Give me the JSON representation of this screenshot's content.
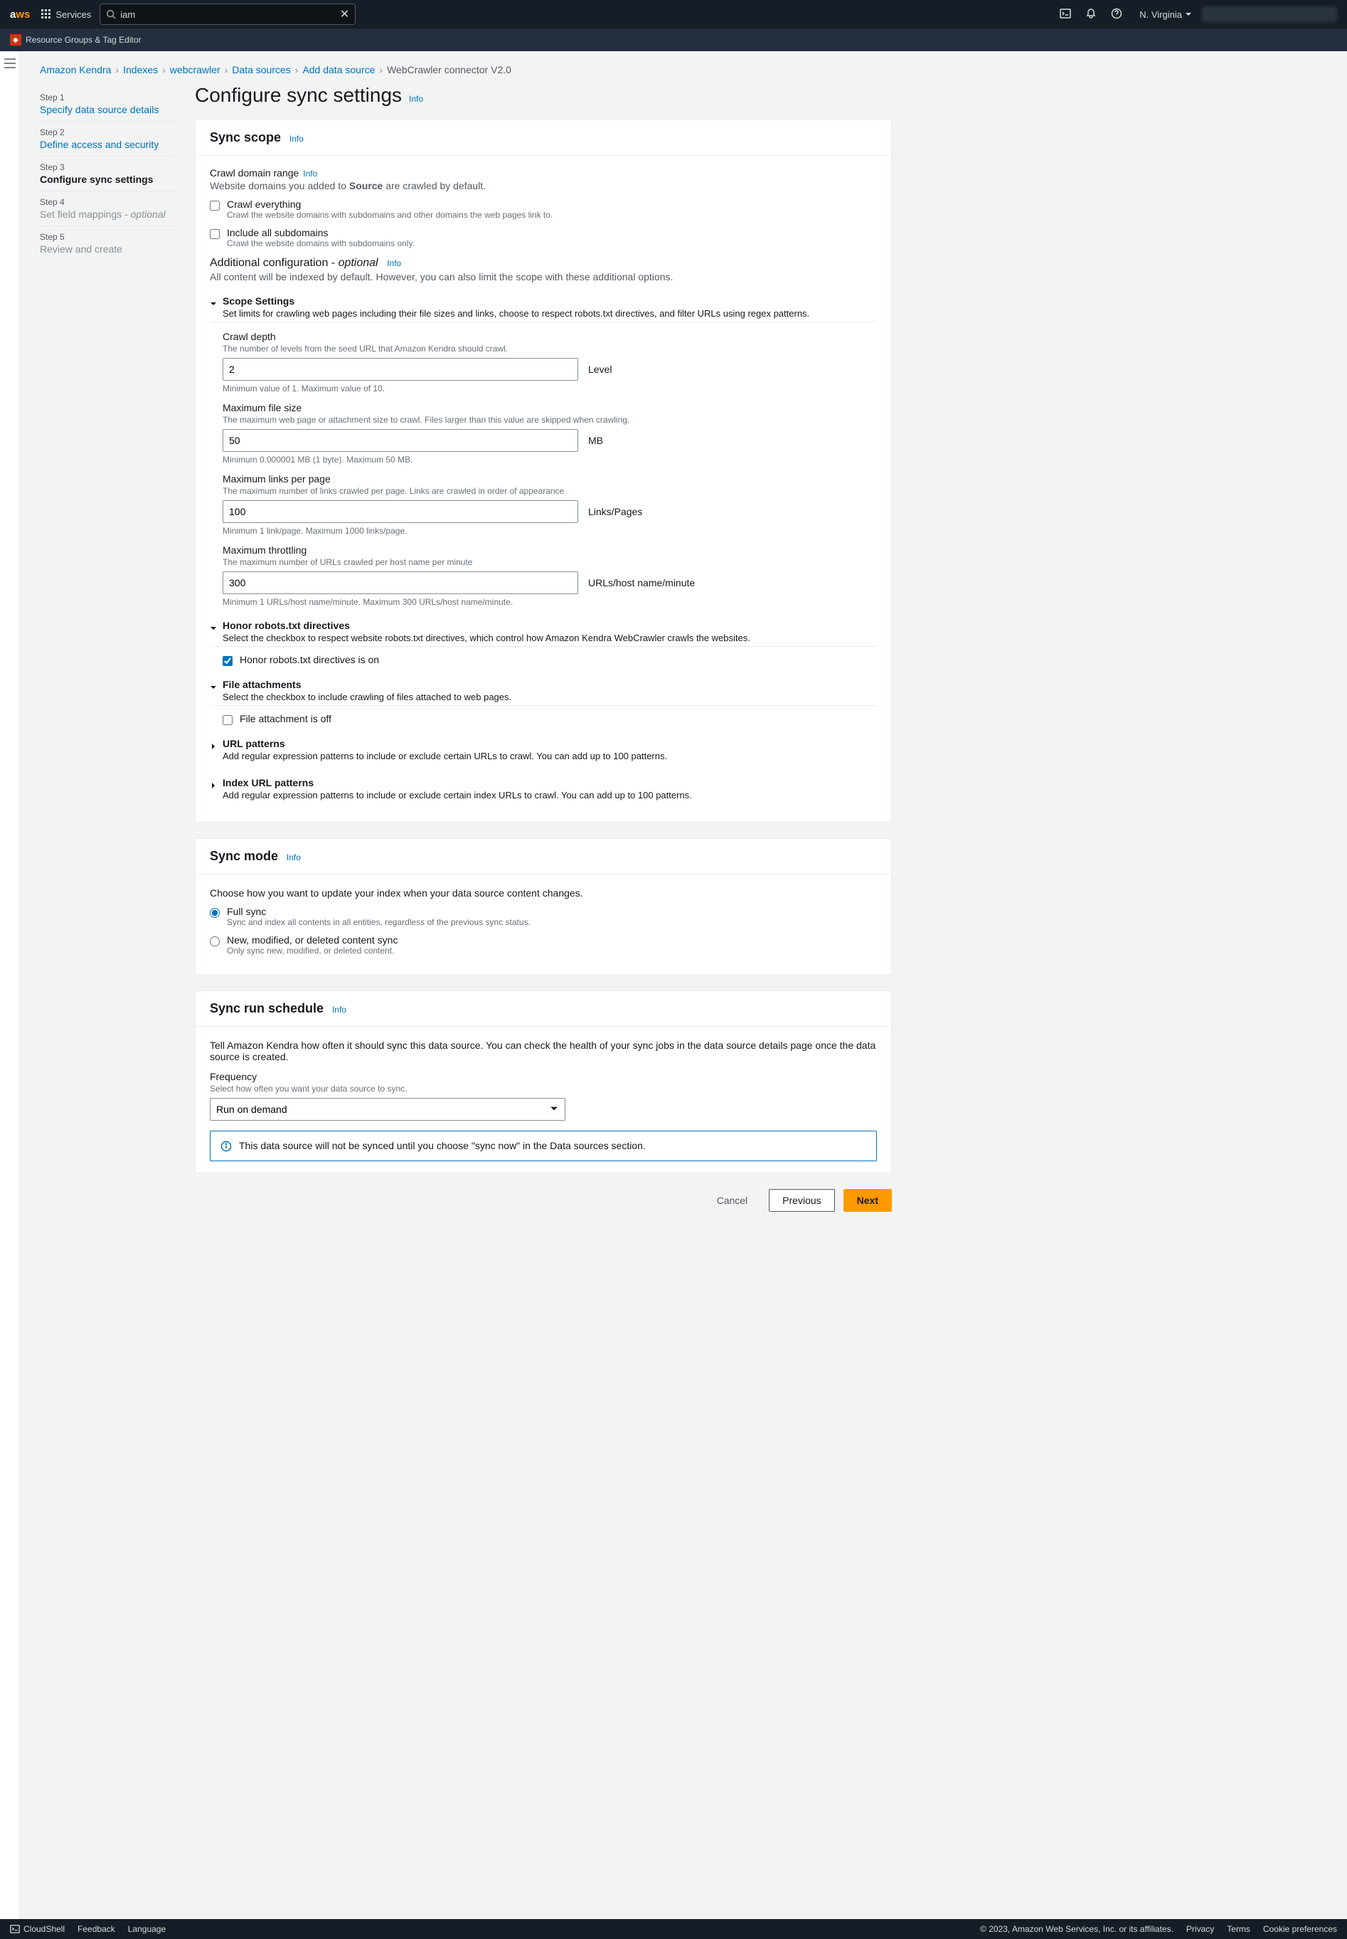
{
  "top": {
    "logo_a": "a",
    "logo_ws": "ws",
    "services": "Services",
    "search_value": "iam",
    "region": "N. Virginia"
  },
  "secbar": {
    "text": "Resource Groups & Tag Editor"
  },
  "crumbs": {
    "c1": "Amazon Kendra",
    "c2": "Indexes",
    "c3": "webcrawler",
    "c4": "Data sources",
    "c5": "Add data source",
    "c6": "WebCrawler connector V2.0"
  },
  "steps": {
    "s1n": "Step 1",
    "s1t": "Specify data source details",
    "s2n": "Step 2",
    "s2t": "Define access and security",
    "s3n": "Step 3",
    "s3t": "Configure sync settings",
    "s4n": "Step 4",
    "s4t": "Set field mappings - ",
    "s4i": "optional",
    "s5n": "Step 5",
    "s5t": "Review and create"
  },
  "info": "Info",
  "h1": "Configure sync settings",
  "scope": {
    "title": "Sync scope",
    "crawlrange_l": "Crawl domain range",
    "crawlrange_d_pre": "Website domains you added to ",
    "crawlrange_d_b": "Source",
    "crawlrange_d_post": " are crawled by default.",
    "ck1_h": "Crawl everything",
    "ck1_d": "Crawl the website domains with subdomains and other domains the web pages link to.",
    "ck2_h": "Include all subdomains",
    "ck2_d": "Crawl the website domains with subdomains only.",
    "addl_h_a": "Additional configuration - ",
    "addl_h_i": "optional",
    "addl_d": "All content will be indexed by default. However, you can also limit the scope with these additional options.",
    "exp1_t": "Scope Settings",
    "exp1_d": "Set limits for crawling web pages including their file sizes and links, choose to respect robots.txt directives, and filter URLs using regex patterns.",
    "depth_l": "Crawl depth",
    "depth_d": "The number of levels from the seed URL that Amazon Kendra should crawl.",
    "depth_v": "2",
    "depth_u": "Level",
    "depth_hint": "Minimum value of 1. Maximum value of 10.",
    "mfs_l": "Maximum file size",
    "mfs_d": "The maximum web page or attachment size to crawl. Files larger than this value are skipped when crawling.",
    "mfs_v": "50",
    "mfs_u": "MB",
    "mfs_hint": "Minimum 0.000001 MB (1 byte). Maximum 50 MB.",
    "mlp_l": "Maximum links per page",
    "mlp_d": "The maximum number of links crawled per page. Links are crawled in order of appearance",
    "mlp_v": "100",
    "mlp_u": "Links/Pages",
    "mlp_hint": "Minimum 1 link/page. Maximum 1000 links/page.",
    "mth_l": "Maximum throttling",
    "mth_d": "The maximum number of URLs crawled per host name per minute",
    "mth_v": "300",
    "mth_u": "URLs/host name/minute",
    "mth_hint": "Minimum 1 URLs/host name/minute. Maximum 300 URLs/host name/minute.",
    "exp2_t": "Honor robots.txt directives",
    "exp2_d": "Select the checkbox to respect website robots.txt directives, which control how Amazon Kendra WebCrawler crawls the websites.",
    "honor_ck": "Honor robots.txt directives is on",
    "exp3_t": "File attachments",
    "exp3_d": "Select the checkbox to include crawling of files attached to web pages.",
    "fatt_ck": "File attachment is off",
    "exp4_t": "URL patterns",
    "exp4_d": "Add regular expression patterns to include or exclude certain URLs to crawl. You can add up to 100 patterns.",
    "exp5_t": "Index URL patterns",
    "exp5_d": "Add regular expression patterns to include or exclude certain index URLs to crawl. You can add up to 100 patterns."
  },
  "mode": {
    "title": "Sync mode",
    "desc": "Choose how you want to update your index when your data source content changes.",
    "r1_h": "Full sync",
    "r1_d": "Sync and index all contents in all entities, regardless of the previous sync status.",
    "r2_h": "New, modified, or deleted content sync",
    "r2_d": "Only sync new, modified, or deleted content."
  },
  "sched": {
    "title": "Sync run schedule",
    "desc": "Tell Amazon Kendra how often it should sync this data source. You can check the health of your sync jobs in the data source details page once the data source is created.",
    "freq_l": "Frequency",
    "freq_d": "Select how often you want your data source to sync.",
    "freq_v": "Run on demand",
    "alert": "This data source will not be synced until you choose \"sync now\" in the Data sources section."
  },
  "actions": {
    "cancel": "Cancel",
    "previous": "Previous",
    "next": "Next"
  },
  "footer": {
    "cloudshell": "CloudShell",
    "feedback": "Feedback",
    "language": "Language",
    "copy": "© 2023, Amazon Web Services, Inc. or its affiliates.",
    "privacy": "Privacy",
    "terms": "Terms",
    "cookie": "Cookie preferences"
  }
}
